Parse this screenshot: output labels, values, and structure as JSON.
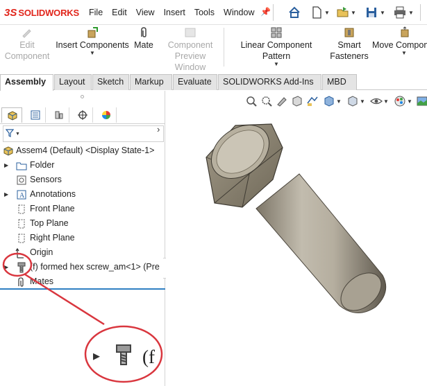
{
  "app": {
    "logo_mark": "3S",
    "brand": "SOLIDWORKS"
  },
  "menu": [
    "File",
    "Edit",
    "View",
    "Insert",
    "Tools",
    "Window"
  ],
  "toolbar_icons": [
    "pin-icon",
    "home-icon",
    "new-document-icon",
    "open-icon",
    "save-icon",
    "print-icon"
  ],
  "commands": [
    {
      "line1": "Edit",
      "line2": "Component",
      "enabled": false
    },
    {
      "line1": "Insert Components",
      "line2": "",
      "enabled": true
    },
    {
      "line1": "Mate",
      "line2": "",
      "enabled": true
    },
    {
      "line1": "Component",
      "line2": "Preview Window",
      "enabled": false
    },
    {
      "line1": "Linear Component Pattern",
      "line2": "",
      "enabled": true
    },
    {
      "line1": "Smart",
      "line2": "Fasteners",
      "enabled": true
    },
    {
      "line1": "Move Compon",
      "line2": "",
      "enabled": true
    }
  ],
  "tabs": [
    "Assembly",
    "Layout",
    "Sketch",
    "Markup",
    "Evaluate",
    "SOLIDWORKS Add-Ins",
    "MBD"
  ],
  "active_tab": "Assembly",
  "tree": {
    "root": "Assem4 (Default) <Display State-1>",
    "items": [
      {
        "label": "Folder",
        "icon": "folder-icon",
        "expandable": true
      },
      {
        "label": "Sensors",
        "icon": "sensor-icon",
        "expandable": false
      },
      {
        "label": "Annotations",
        "icon": "annotation-icon",
        "expandable": true
      },
      {
        "label": "Front Plane",
        "icon": "plane-icon",
        "expandable": false
      },
      {
        "label": "Top Plane",
        "icon": "plane-icon",
        "expandable": false
      },
      {
        "label": "Right Plane",
        "icon": "plane-icon",
        "expandable": false
      },
      {
        "label": "Origin",
        "icon": "origin-icon",
        "expandable": false
      },
      {
        "label": "(f) formed hex screw_am<1> (Pre",
        "icon": "screw-part-icon",
        "expandable": true
      },
      {
        "label": "Mates",
        "icon": "mates-icon",
        "expandable": false
      }
    ]
  },
  "zoom_callout": {
    "text": "(f"
  },
  "colors": {
    "brand_red": "#e1251b",
    "annotation_red": "#d9363e",
    "divider_blue": "#2f7fc2"
  }
}
